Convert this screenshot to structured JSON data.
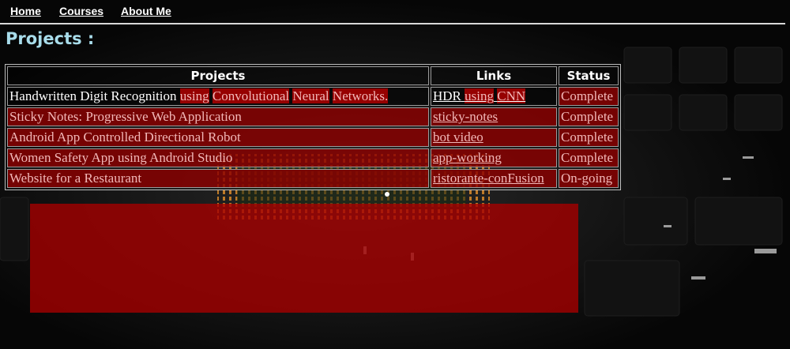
{
  "nav": {
    "home": "Home",
    "courses": "Courses",
    "about": "About Me"
  },
  "page": {
    "title": "Projects :"
  },
  "table": {
    "headers": {
      "projects": "Projects",
      "links": "Links",
      "status": "Status"
    },
    "rows": [
      {
        "project_parts": [
          "Handwritten Digit Recognition ",
          "using",
          " ",
          "Convolutional",
          " ",
          "Neural",
          " ",
          "Networks."
        ],
        "link_parts": [
          "HDR",
          " ",
          "using",
          " ",
          "CNN"
        ],
        "status": "Complete"
      },
      {
        "project": "Sticky Notes: Progressive Web Application",
        "link": "sticky-notes",
        "status": "Complete"
      },
      {
        "project": "Android App Controlled Directional Robot",
        "link": "bot video",
        "status": "Complete"
      },
      {
        "project": "Women Safety App using Android Studio",
        "link": "app-working",
        "status": "Complete"
      },
      {
        "project": "Website for a Restaurant",
        "link": "ristorante-conFusion",
        "status": "On-going"
      }
    ]
  },
  "colors": {
    "highlight_red": "#8c0000",
    "title_blue": "#a8dcea",
    "nav_text": "#ffffff"
  }
}
